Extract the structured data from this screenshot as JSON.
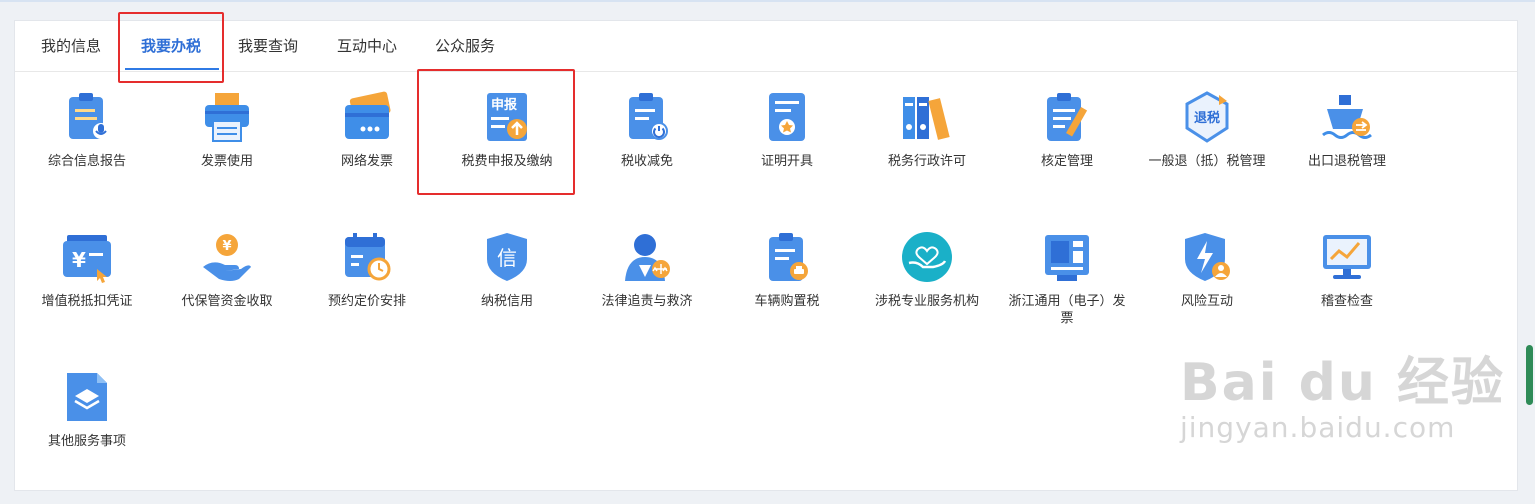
{
  "tabs": [
    {
      "label": "我的信息"
    },
    {
      "label": "我要办税"
    },
    {
      "label": "我要查询"
    },
    {
      "label": "互动中心"
    },
    {
      "label": "公众服务"
    }
  ],
  "active_tab": "我要办税",
  "items": [
    {
      "label": "综合信息报告",
      "icon": "clipboard-mic-icon"
    },
    {
      "label": "发票使用",
      "icon": "printer-icon"
    },
    {
      "label": "网络发票",
      "icon": "card-icon"
    },
    {
      "label": "税费申报及缴纳",
      "icon": "declare-upload-icon"
    },
    {
      "label": "税收减免",
      "icon": "clipboard-power-icon"
    },
    {
      "label": "证明开具",
      "icon": "certificate-star-icon"
    },
    {
      "label": "税务行政许可",
      "icon": "binders-icon"
    },
    {
      "label": "核定管理",
      "icon": "clipboard-pencil-icon"
    },
    {
      "label": "一般退（抵）税管理",
      "icon": "refund-hexagon-icon",
      "badge": "退税"
    },
    {
      "label": "出口退税管理",
      "icon": "ship-icon"
    },
    {
      "label": "增值税抵扣凭证",
      "icon": "yuan-cards-icon",
      "badge": "¥"
    },
    {
      "label": "代保管资金收取",
      "icon": "hand-coin-icon",
      "badge": "¥"
    },
    {
      "label": "预约定价安排",
      "icon": "calendar-clock-icon"
    },
    {
      "label": "纳税信用",
      "icon": "credit-shield-icon",
      "badge": "信"
    },
    {
      "label": "法律追责与救济",
      "icon": "justice-person-icon"
    },
    {
      "label": "车辆购置税",
      "icon": "clipboard-car-icon"
    },
    {
      "label": "涉税专业服务机构",
      "icon": "hand-heart-icon"
    },
    {
      "label": "浙江通用（电子）发票",
      "icon": "invoice-board-icon"
    },
    {
      "label": "风险互动",
      "icon": "shield-bolt-icon"
    },
    {
      "label": "稽查检查",
      "icon": "monitor-chart-icon"
    },
    {
      "label": "其他服务事项",
      "icon": "layers-doc-icon"
    }
  ],
  "declare_badge": "申报",
  "watermark": {
    "main": "Bai du 经验",
    "sub": "jingyan.baidu.com"
  },
  "colors": {
    "accent": "#2f7ae5",
    "highlight_box": "#e52d2d",
    "icon_blue": "#3f8ee8",
    "icon_orange": "#f5a53a"
  }
}
